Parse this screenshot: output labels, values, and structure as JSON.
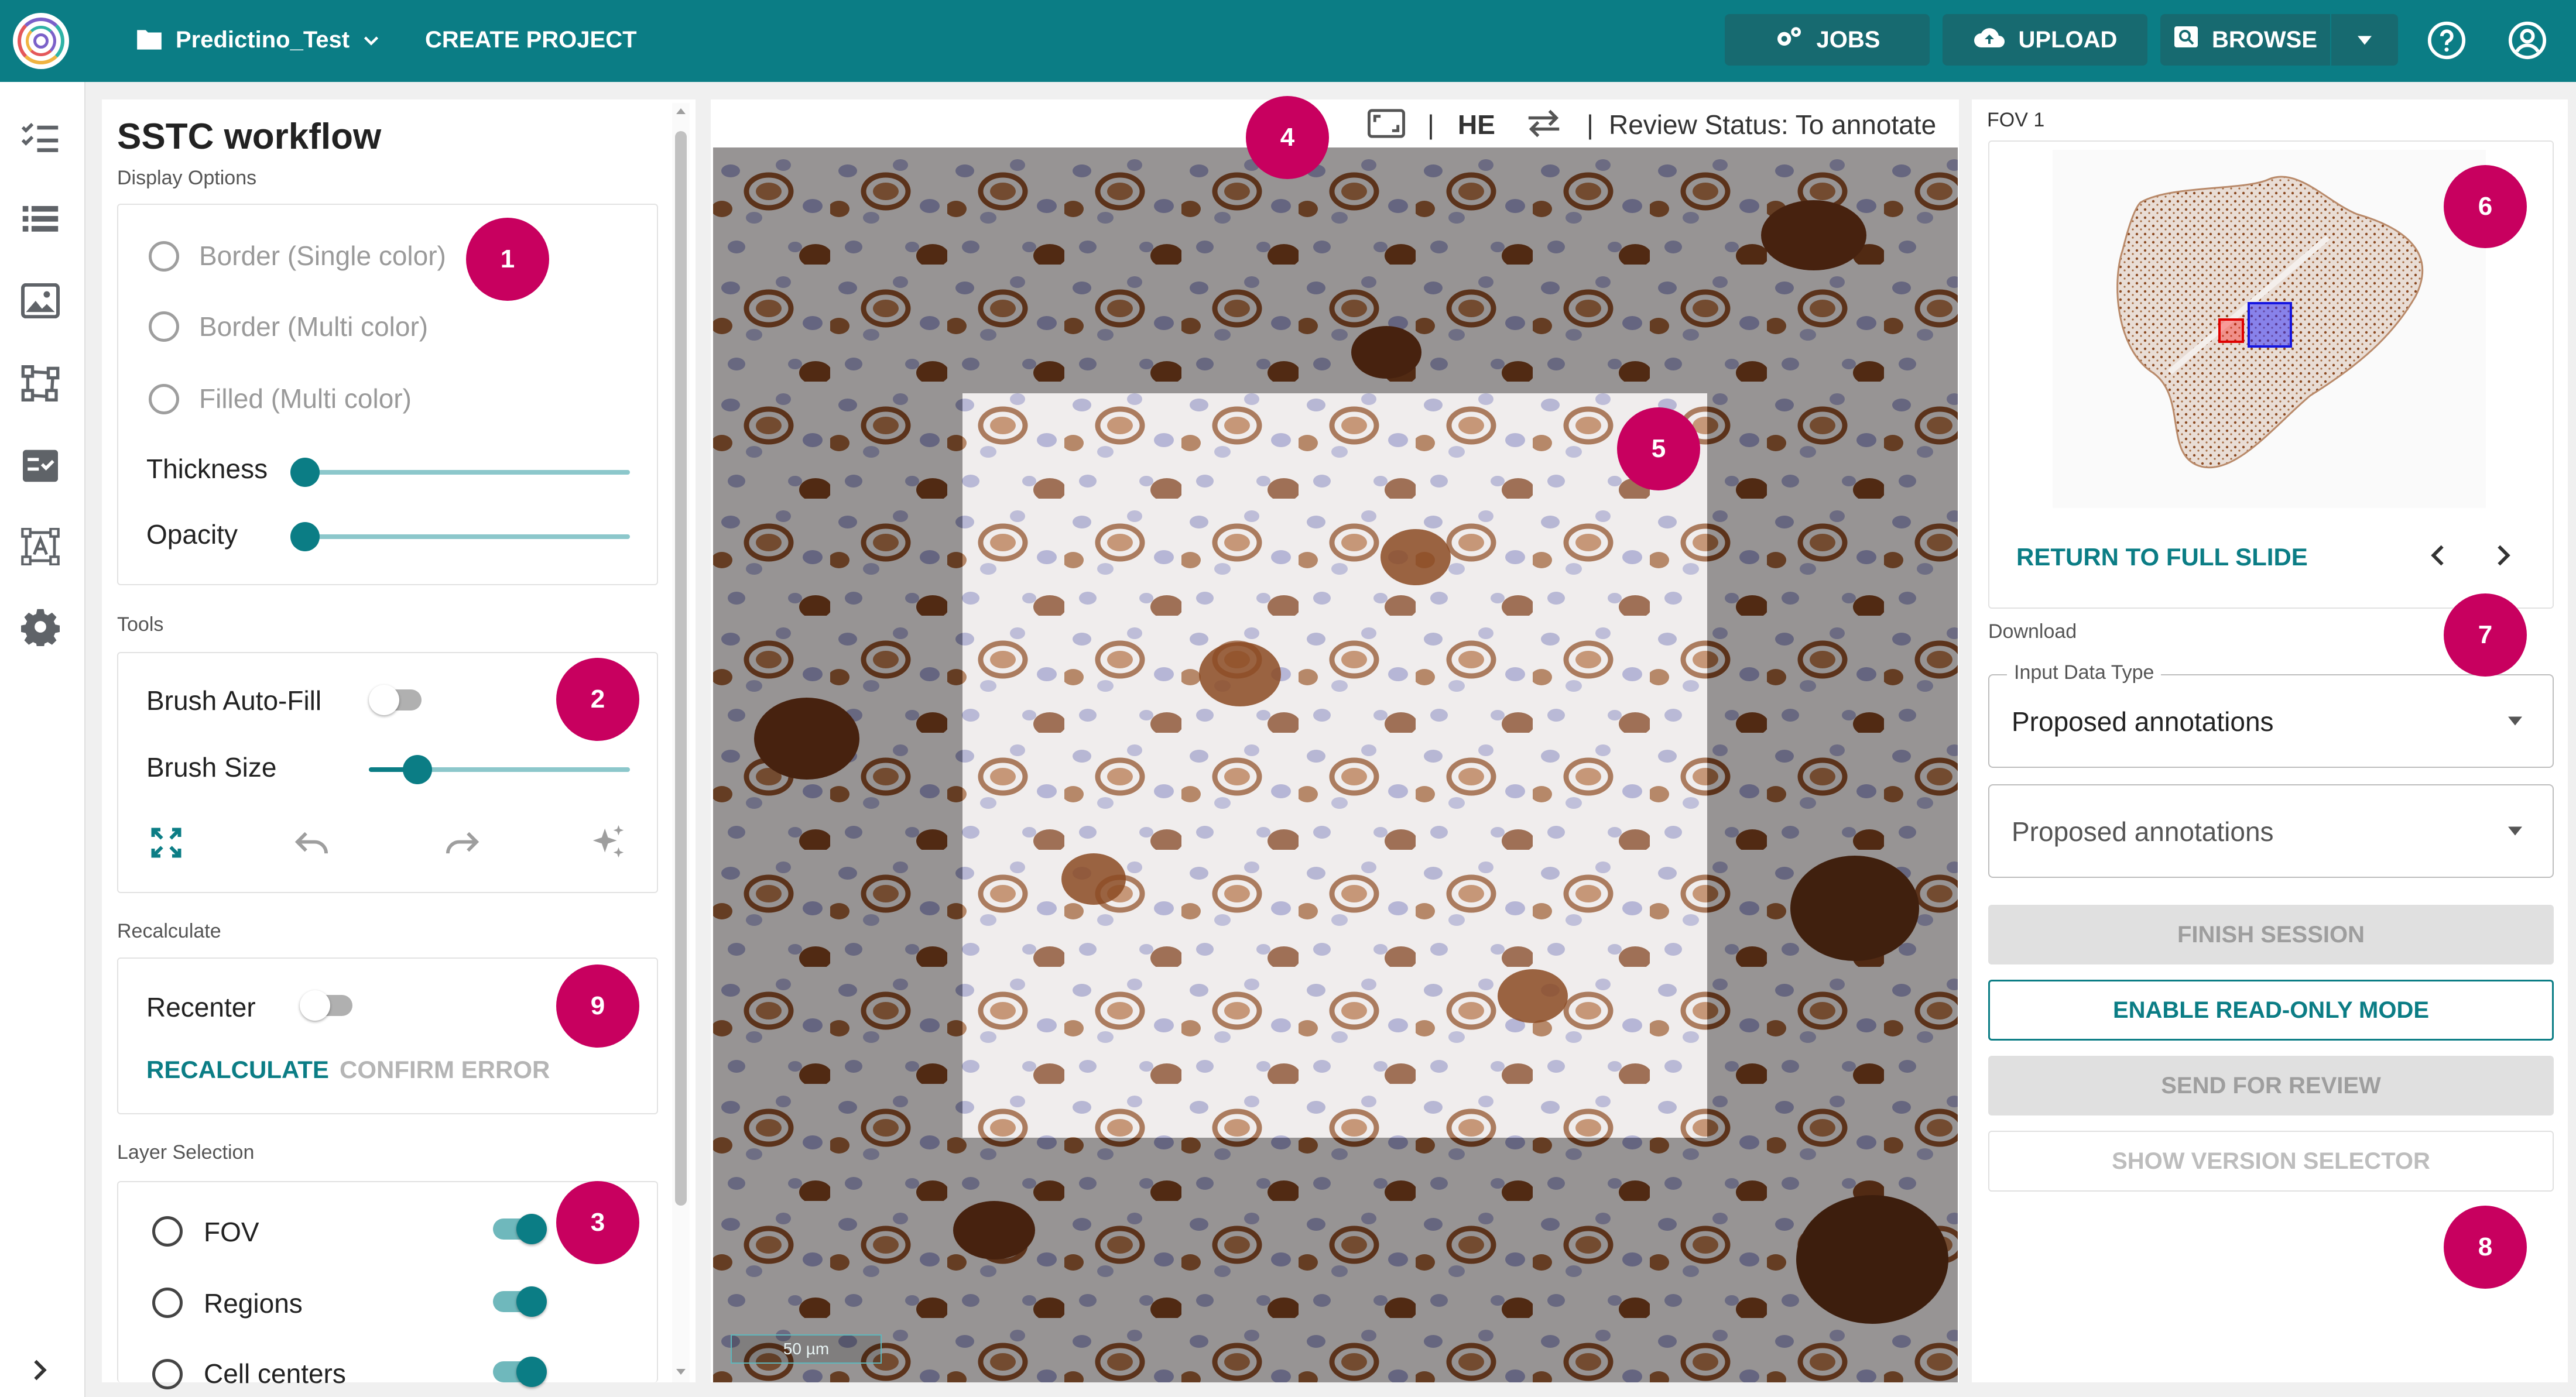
{
  "header": {
    "project_name": "Predictino_Test",
    "create_project_label": "CREATE PROJECT",
    "jobs_label": "JOBS",
    "upload_label": "UPLOAD",
    "browse_label": "BROWSE",
    "bar_color": "#0b7d85"
  },
  "sidebar": {
    "icons": [
      "checklist-icon",
      "list-icon",
      "image-icon",
      "polygon-icon",
      "task-icon",
      "text-box-icon",
      "gear-icon"
    ],
    "expand_icon": "chevron-right-icon"
  },
  "left_panel": {
    "title": "SSTC workflow",
    "display_options_label": "Display Options",
    "display_options": [
      "Border (Single color)",
      "Border (Multi color)",
      "Filled (Multi color)"
    ],
    "thickness_label": "Thickness",
    "opacity_label": "Opacity",
    "thickness_value": 0,
    "opacity_value": 0,
    "tools_label": "Tools",
    "brush_autofill_label": "Brush Auto-Fill",
    "brush_autofill_on": false,
    "brush_size_label": "Brush Size",
    "brush_size_value": 0.2,
    "tool_icons": [
      "fit-screen-icon",
      "undo-icon",
      "redo-icon",
      "sparkle-icon"
    ],
    "recalculate_section_label": "Recalculate",
    "recenter_label": "Recenter",
    "recenter_on": false,
    "recalculate_button": "RECALCULATE",
    "confirm_error_button": "CONFIRM ERROR",
    "layer_selection_label": "Layer Selection",
    "layers": [
      {
        "label": "FOV",
        "on": true
      },
      {
        "label": "Regions",
        "on": true
      },
      {
        "label": "Cell centers",
        "on": true
      }
    ]
  },
  "viewer": {
    "stain": "HE",
    "review_status": "Review Status: To annotate",
    "separator": "|",
    "scale_bar": "50 µm"
  },
  "right_panel": {
    "fov_label": "FOV 1",
    "return_label": "RETURN TO FULL SLIDE",
    "download_label": "Download",
    "input_type_label": "Input Data Type",
    "input_type_value": "Proposed annotations",
    "second_select_value": "Proposed annotations",
    "finish_session": "FINISH SESSION",
    "enable_readonly": "ENABLE READ-ONLY MODE",
    "send_for_review": "SEND FOR REVIEW",
    "show_version_selector": "SHOW VERSION SELECTOR"
  },
  "callouts": [
    "1",
    "2",
    "3",
    "4",
    "5",
    "6",
    "7",
    "8",
    "9"
  ]
}
